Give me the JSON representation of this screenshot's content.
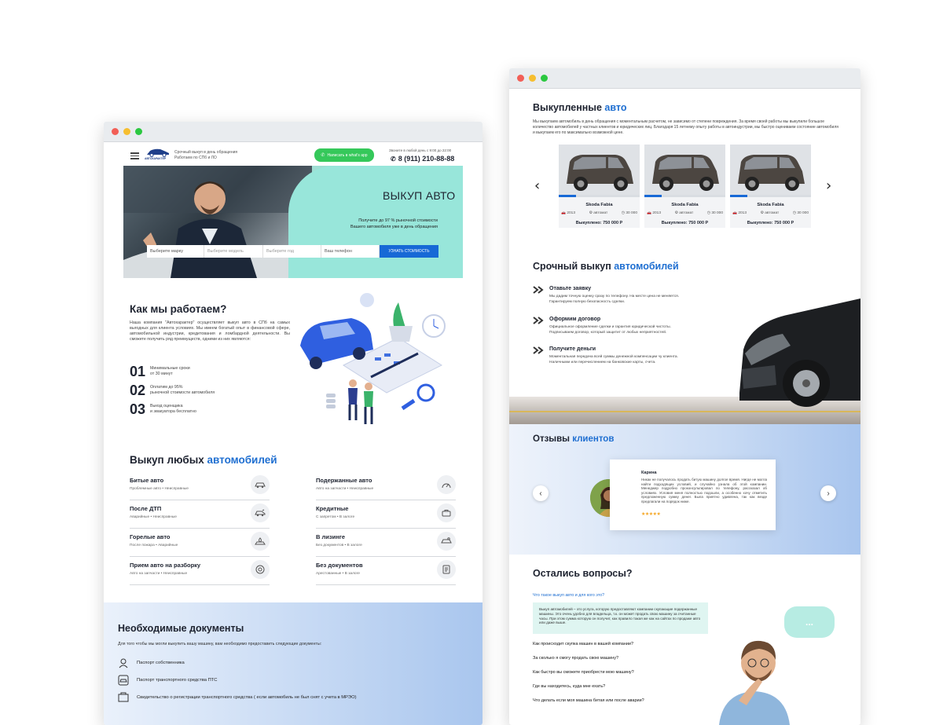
{
  "left": {
    "header": {
      "logo_text": "АВТОХАРАКТЕР",
      "tagline_1": "Срочный выкуп в день обращения",
      "tagline_2": "Работаем по СПб и ЛО",
      "whatsapp_label": "Написать в what's app",
      "call_note": "Звоните в любой день с 9:00 до 22:00",
      "phone": "8 (911) 210-88-88"
    },
    "hero": {
      "title": "ВЫКУП АВТО",
      "subtitle_1": "Получите до 97 % рыночной стоимости",
      "subtitle_2": "Вашего автомобиля уже в день обращения",
      "brand_placeholder": "Выберите марку",
      "model_placeholder": "Выберите модель",
      "year_placeholder": "Выберите год",
      "phone_placeholder": "Ваш телефон",
      "submit_label": "УЗНАТЬ СТОИМОСТЬ"
    },
    "how": {
      "title": "Как мы работаем?",
      "text": "Наша компания \"Автохарактер\" осуществляет выкуп авто в СПб на самых выгодных для клиента условиях. Мы имеем богатый опыт в финансовой сфере, автомобильной индустрии, кредитования и ломбардной деятельности. Вы сможете получить ряд преимуществ, одними из них являются:",
      "steps": [
        {
          "num": "01",
          "l1": "Минимальные сроки",
          "l2": "от 30 минут"
        },
        {
          "num": "02",
          "l1": "Оплатим до 95%",
          "l2": "рыночной стоимости автомобиля"
        },
        {
          "num": "03",
          "l1": "Выезд оценщика",
          "l2": "и эвакуатора бесплатно"
        }
      ]
    },
    "services": {
      "title_main": "Выкуп любых ",
      "title_accent": "автомобилей",
      "items": [
        {
          "title": "Битые авто",
          "sub": "Проблемные авто  •  Неисправные"
        },
        {
          "title": "Подержанные авто",
          "sub": "Авто на запчасти  •  Неисправные"
        },
        {
          "title": "После ДТП",
          "sub": "Аварийные  •  Неисправные"
        },
        {
          "title": "Кредитные",
          "sub": "С запретом  •  В залоге"
        },
        {
          "title": "Горелые авто",
          "sub": "После пожара  •  Аварийные"
        },
        {
          "title": "В лизинге",
          "sub": "Без документов  •  В залоге"
        },
        {
          "title": "Прием авто на разборку",
          "sub": "Авто на запчасти  •  Неисправные"
        },
        {
          "title": "Без документов",
          "sub": "Арестованные  •  В залоге"
        }
      ]
    },
    "docs": {
      "title": "Необходимые документы",
      "intro": "Для того чтобы мы могли выкупить вашу машину, вам необходимо предоставить следующие документы:",
      "items": [
        "Паспорт собственника",
        "Паспорт транспортного средства ПТС",
        "Свидетельство о регистрации транспортного средства ( если автомобиль не был снят с учета в МРЭО)"
      ]
    }
  },
  "right": {
    "bought": {
      "title_main": "Выкупленные ",
      "title_accent": "авто",
      "text": "Мы выкупаем автомобиль в день обращения с моментальным расчетом, не зависимо от степени повреждения. За время своей работы мы выкупили большое количество автомобилей у частных клиентов и юридических лиц. Благодаря 15 летнему опыту работы в автоиндустрии, мы быстро оцениваем состояние автомобиля и выкупаем его по максимально возможной цене.",
      "cars": [
        {
          "name": "Skoda Fabia",
          "year": "2013",
          "gear": "автомат",
          "km": "30 000",
          "price": "Выкуплено: 750 000 Р"
        },
        {
          "name": "Skoda Fabia",
          "year": "2013",
          "gear": "автомат",
          "km": "30 000",
          "price": "Выкуплено: 750 000 Р"
        },
        {
          "name": "Skoda Fabia",
          "year": "2013",
          "gear": "автомат",
          "km": "30 000",
          "price": "Выкуплено: 750 000 Р"
        }
      ]
    },
    "urgent": {
      "title_main": "Срочный выкуп ",
      "title_accent": "автомобилей",
      "steps": [
        {
          "title": "Отавьте заявку",
          "l1": "Мы дадим точную оценку сразу по телефону. На месте цена не меняется.",
          "l2": "Гарантируем полную безопасность сделки."
        },
        {
          "title": "Оформим договор",
          "l1": "Официальное оформление сделки и гарантия юридической чистоты.",
          "l2": "Подписываем договор, который защитит от любых неприятностей."
        },
        {
          "title": "Получите деньги",
          "l1": "Моментальная передача всей суммы денежной компенсации чу клиента.",
          "l2": "Наличными или перечислением на банковские карты, счета."
        }
      ]
    },
    "reviews": {
      "title_main": "Отзывы ",
      "title_accent": "клиентов",
      "name": "Карина",
      "text": "Никак не получалось продать битую машину долгое время. Нигде не могла найти подходящих условий, и случайно узнала об этой компании. Менеджер подробно проконсультировал по телефону, рассказал об условиях. Условия меня полностью подошли, а особенно хочу отметить предложенную сумму денег. Была приятно удивлена, так как везде предлагали на порядок ниже.",
      "stars": "★★★★★"
    },
    "faq": {
      "title": "Остались вопросы?",
      "open_q": "Что такое выкуп авто и для кого это?",
      "open_a": "Выкуп автомобилей – это услуга, которую предоставляют компании скупающие подержанные машины. Это очень удобно для владельца, т.к. он может продать свою машину за считанные часы. При этом сумма которую он получит, как правило такая же как на сайтах по продаже авто или даже выше.",
      "questions": [
        "Как происходит скупка машин в вашей компании?",
        "За сколько я смогу продать свою машину?",
        "Как быстро вы сможете приобрести мою машину?",
        "Где вы находитесь, куда мне ехать?",
        "Что делать если моя машина битая или после аварии?"
      ],
      "bubble": "..."
    }
  }
}
